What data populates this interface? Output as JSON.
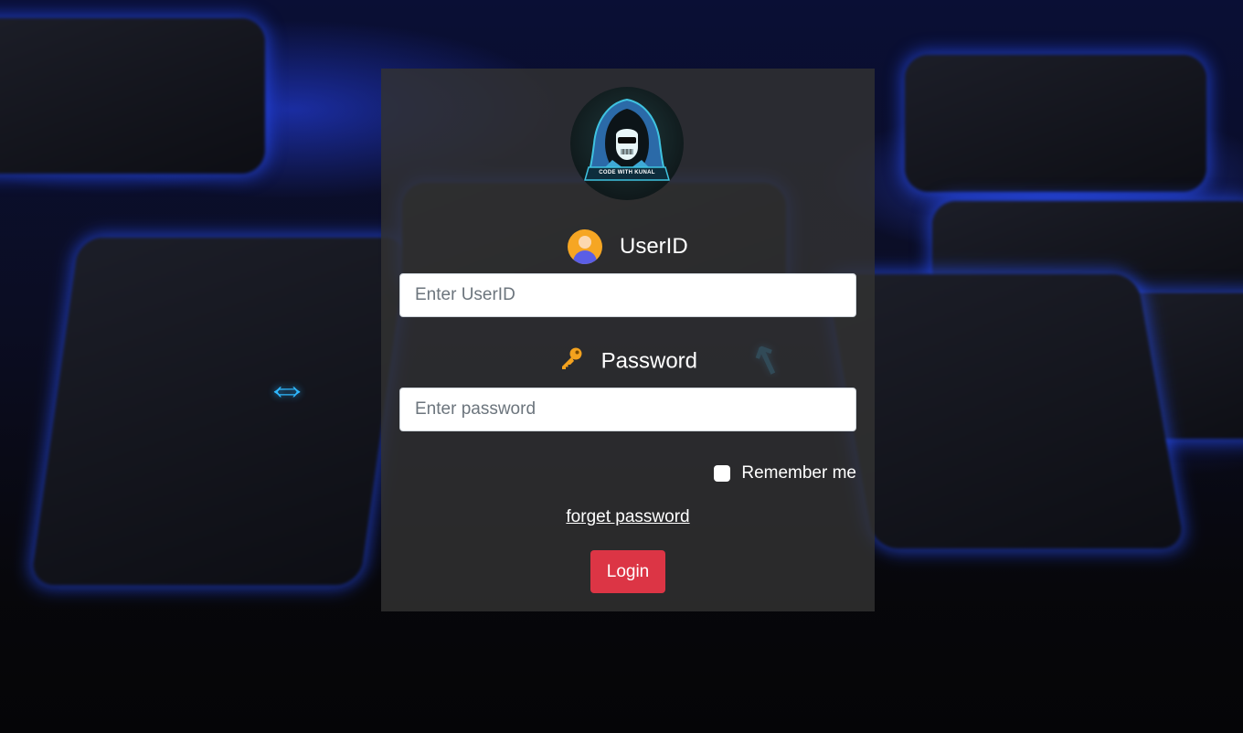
{
  "logo": {
    "text": "CODE WITH KUNAL"
  },
  "userid": {
    "label": "UserID",
    "placeholder": "Enter UserID",
    "value": ""
  },
  "password": {
    "label": "Password",
    "placeholder": "Enter password",
    "value": ""
  },
  "remember": {
    "label": "Remember me",
    "checked": false
  },
  "forget_link": "forget password",
  "login_button": "Login",
  "colors": {
    "panel": "#323232",
    "login_button": "#dc3545",
    "text": "#ffffff",
    "background_glow": "#2a4bff"
  },
  "icons": {
    "userid": "user-avatar-icon",
    "password": "key-icon",
    "logo": "hooded-hacker-logo-icon"
  }
}
